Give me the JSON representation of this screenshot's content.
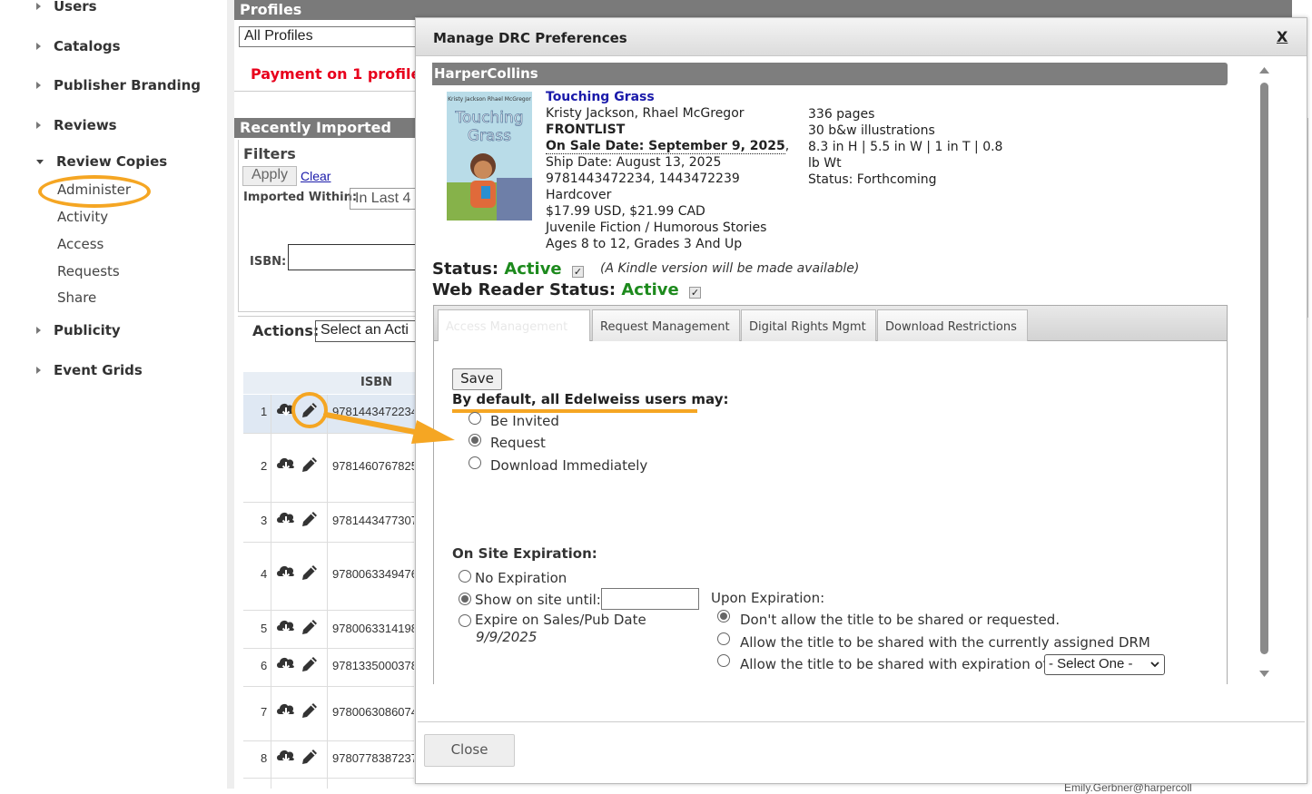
{
  "sidebar": {
    "items": [
      {
        "label": "Users"
      },
      {
        "label": "Catalogs"
      },
      {
        "label": "Publisher Branding"
      },
      {
        "label": "Reviews"
      },
      {
        "label": "Review Copies"
      },
      {
        "label": "Publicity"
      },
      {
        "label": "Event Grids"
      }
    ],
    "review_copies_sub": [
      {
        "label": "Administer"
      },
      {
        "label": "Activity"
      },
      {
        "label": "Access"
      },
      {
        "label": "Requests"
      },
      {
        "label": "Share"
      }
    ]
  },
  "background": {
    "profiles_header": "Profiles",
    "profiles_select": "All Profiles",
    "payment_warning": "Payment on 1 profile i",
    "recently_imported_header": "Recently Imported",
    "filters_label": "Filters",
    "apply_label": "Apply",
    "clear_label": "Clear",
    "imported_within_label": "Imported Within:",
    "imported_within_value": "In Last 4",
    "isbn_label": "ISBN:",
    "actions_label": "Actions:",
    "actions_select": "Select an Acti",
    "isbn_column_header": "ISBN",
    "rows": [
      {
        "num": "1",
        "isbn": "9781443472234"
      },
      {
        "num": "2",
        "isbn": "9781460767825"
      },
      {
        "num": "3",
        "isbn": "9781443477307"
      },
      {
        "num": "4",
        "isbn": "9780063349476"
      },
      {
        "num": "5",
        "isbn": "9780063314198"
      },
      {
        "num": "6",
        "isbn": "9781335000378"
      },
      {
        "num": "7",
        "isbn": "9780063086074"
      },
      {
        "num": "8",
        "isbn": "9780778387237"
      }
    ],
    "footer_email": "Emily.Gerbner@harpercoll"
  },
  "modal": {
    "title": "Manage DRC Preferences",
    "close_x": "X",
    "publisher": "HarperCollins",
    "book": {
      "cover_title": "Touching Grass",
      "cover_authors": "Kristy Jackson   Rhael McGregor",
      "title": "Touching Grass",
      "authors": "Kristy Jackson, Rhael McGregor",
      "list": "FRONTLIST",
      "on_sale": "On Sale Date: September 9, 2025",
      "on_sale_comma": ",",
      "ship_date": "Ship Date: August 13, 2025",
      "isbns": "9781443472234, 1443472239",
      "format": "Hardcover",
      "price": "$17.99 USD, $21.99 CAD",
      "category": "Juvenile Fiction / Humorous Stories",
      "ages": "Ages 8 to 12, Grades 3 And Up",
      "pages": "336 pages",
      "illustrations": "30 b&w illustrations",
      "dimensions_1": "8.3 in H | 5.5 in W | 1 in T | 0.8",
      "dimensions_2": "lb Wt",
      "status": "Status: Forthcoming"
    },
    "status_label": "Status:",
    "status_value": "Active",
    "kindle_note": "(A Kindle version will be made available)",
    "web_reader_label": "Web Reader Status:",
    "web_reader_value": "Active",
    "check_mark": "✓",
    "tabs": [
      {
        "label": "Access Management"
      },
      {
        "label": "Request Management"
      },
      {
        "label": "Digital Rights Mgmt"
      },
      {
        "label": "Download Restrictions"
      }
    ],
    "save_label": "Save",
    "default_heading": "By default, all Edelweiss users may:",
    "default_options": [
      {
        "label": "Be Invited",
        "checked": false
      },
      {
        "label": "Request",
        "checked": true
      },
      {
        "label": "Download Immediately",
        "checked": false
      }
    ],
    "on_site_heading": "On Site Expiration:",
    "on_site_options": [
      {
        "label": "No Expiration",
        "checked": false
      },
      {
        "label": "Show on site until:",
        "checked": true
      },
      {
        "label": "Expire on Sales/Pub Date",
        "checked": false
      }
    ],
    "pub_date": "9/9/2025",
    "show_until_value": "",
    "upon_expiration_heading": "Upon Expiration:",
    "upon_options": [
      {
        "label": "Don't allow the title to be shared or requested.",
        "checked": true
      },
      {
        "label": "Allow the title to be shared with the currently assigned DRM",
        "checked": false
      },
      {
        "label": "Allow the title to be shared with expiration of",
        "checked": false
      }
    ],
    "expiration_select": "- Select One -",
    "close_button": "Close"
  },
  "colors": {
    "active_green": "#1d8a1d",
    "annotation_orange": "#f5a623",
    "header_gray": "#7a7a7a",
    "link_blue": "#1a1aaa",
    "warning_red": "#e8001c"
  }
}
